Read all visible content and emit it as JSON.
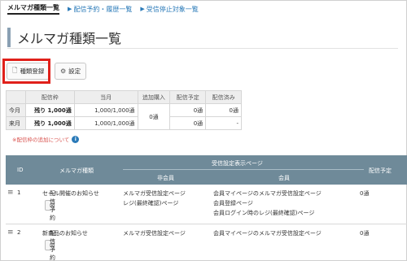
{
  "tabs": [
    {
      "label": "メルマガ種類一覧",
      "active": true
    },
    {
      "label": "配信予約・履歴一覧",
      "active": false
    },
    {
      "label": "受信停止対象一覧",
      "active": false
    }
  ],
  "page_title": "メルマガ種類一覧",
  "buttons": {
    "register_label": "種類登録",
    "settings_label": "設定"
  },
  "quota_table": {
    "headers": [
      "",
      "配信枠",
      "当月",
      "追加購入",
      "配信予定",
      "配信済み"
    ],
    "rows": [
      {
        "label": "今月",
        "remaining": "残り 1,000通",
        "current": "1,000/1,000通",
        "scheduled": "0通",
        "sent": "0通"
      },
      {
        "label": "来月",
        "remaining": "残り 1,000通",
        "current": "1,000/1,000通",
        "scheduled": "0通",
        "sent": "-"
      }
    ],
    "additional": "0通"
  },
  "note": {
    "text": "※配信枠の追加について",
    "icon": "info-icon"
  },
  "grid": {
    "headers": {
      "id": "ID",
      "type": "メルマガ種類",
      "settings_group": "受信設定表示ページ",
      "non_member": "非会員",
      "member": "会員",
      "scheduled": "配信予定"
    },
    "send_button_label": "配信予約",
    "rows": [
      {
        "id": "1",
        "name": "セール開催のお知らせ",
        "non_member": [
          "メルマガ受信設定ページ",
          "レジ(最終確認)ページ"
        ],
        "member": [
          "会員マイページのメルマガ受信設定ページ",
          "会員登録ページ",
          "会員ログイン時のレジ(最終確認)ページ"
        ],
        "scheduled": "0通"
      },
      {
        "id": "2",
        "name": "新商品のお知らせ",
        "non_member": [
          "メルマガ受信設定ページ"
        ],
        "member": [
          "会員マイページのメルマガ受信設定ページ"
        ],
        "scheduled": "0通"
      }
    ]
  }
}
